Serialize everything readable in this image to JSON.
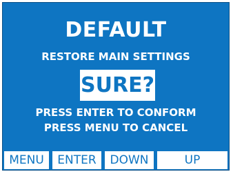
{
  "screen": {
    "title": "DEFAULT",
    "subtitle": "RESTORE MAIN SETTINGS",
    "confirm_prompt": "SURE?",
    "instruction_enter": "PRESS ENTER TO CONFORM",
    "instruction_menu": "PRESS MENU TO CANCEL"
  },
  "softkeys": {
    "menu": "MENU",
    "enter": "ENTER",
    "down": "DOWN",
    "up": "UP"
  },
  "colors": {
    "background": "#0e75c2",
    "text": "#ffffff",
    "button_background": "#ffffff",
    "button_text": "#0e75c2"
  }
}
